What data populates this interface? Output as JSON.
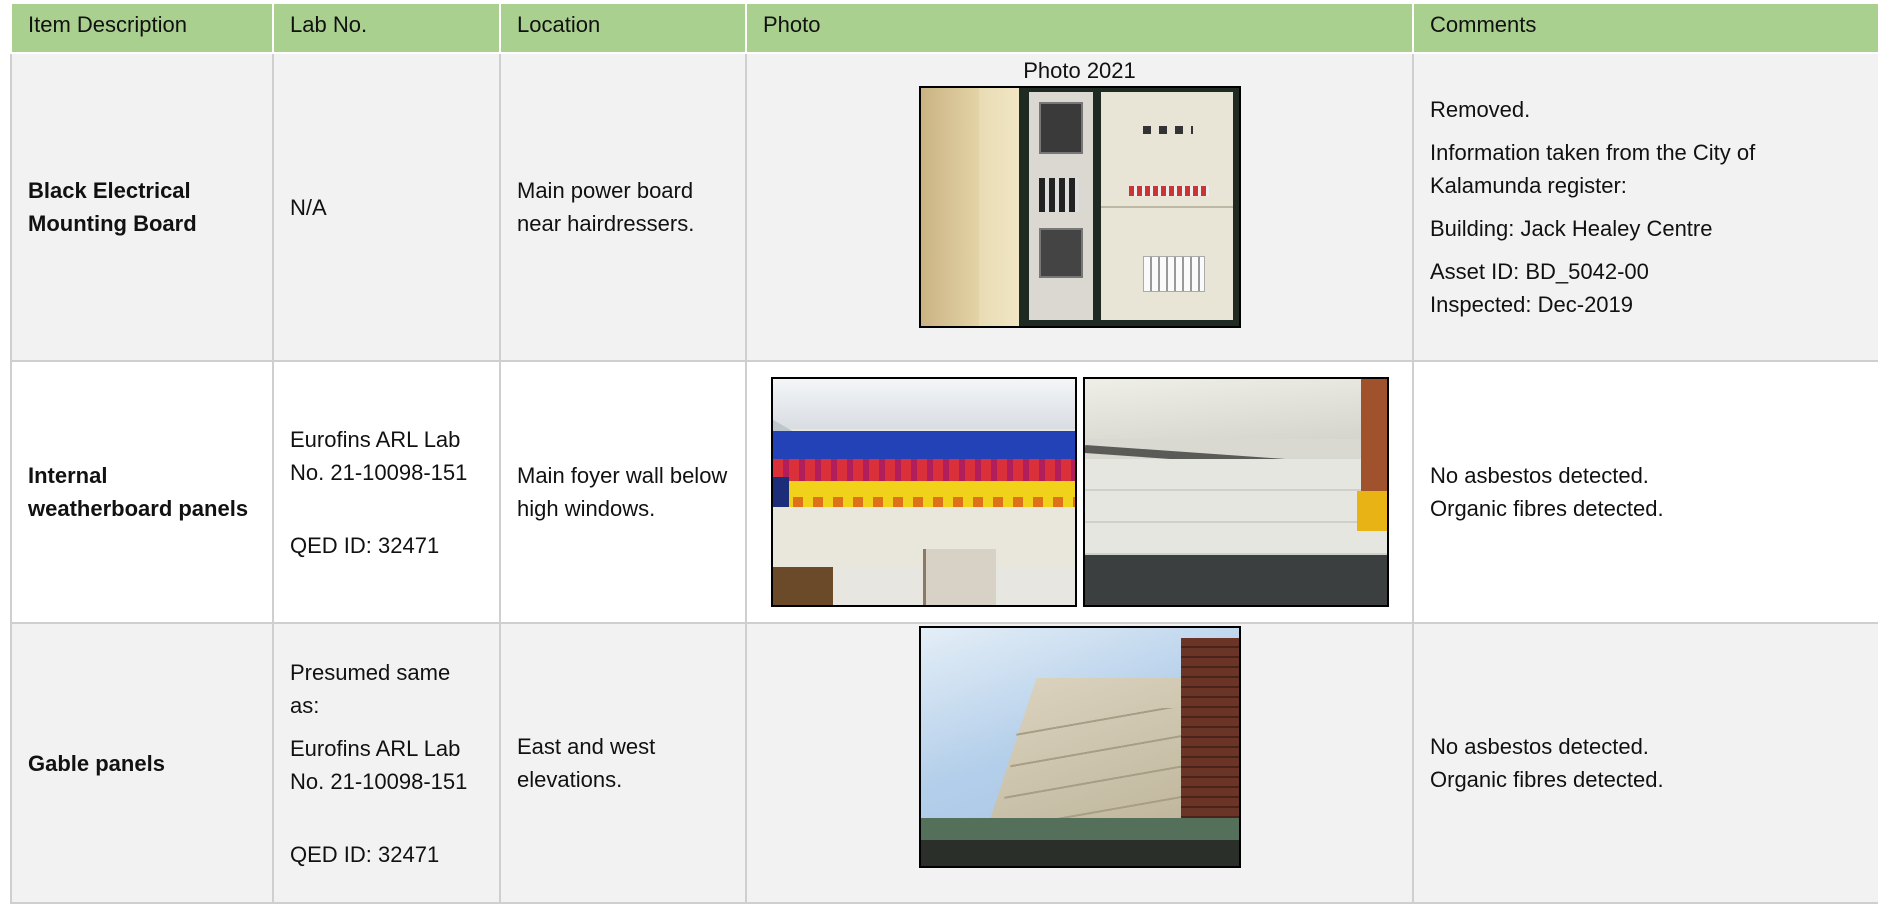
{
  "headers": [
    "Item Description",
    "Lab No.",
    "Location",
    "Photo",
    "Comments"
  ],
  "rows": [
    {
      "item": "Black Electrical Mounting Board",
      "lab": "N/A",
      "location": "Main power board near hairdressers.",
      "photo_caption": "Photo 2021",
      "comments": {
        "c1": "Removed.",
        "c2": "Information taken from the City of Kalamunda register:",
        "c3": "Building: Jack Healey Centre",
        "c4": "Asset ID: BD_5042-00",
        "c5": "Inspected: Dec-2019"
      }
    },
    {
      "item": "Internal weatherboard panels",
      "lab": "Eurofins ARL Lab No. 21-10098-151",
      "qed": "QED ID: 32471",
      "location": "Main foyer wall below high windows.",
      "comments": {
        "c1": "No asbestos detected.",
        "c2": "Organic fibres detected."
      }
    },
    {
      "item": "Gable panels",
      "lab_presumed": "Presumed same as:",
      "lab": "Eurofins ARL Lab No. 21-10098-151",
      "qed": "QED ID: 32471",
      "location": "East and west elevations.",
      "comments": {
        "c1": "No asbestos detected.",
        "c2": "Organic fibres detected."
      }
    }
  ]
}
